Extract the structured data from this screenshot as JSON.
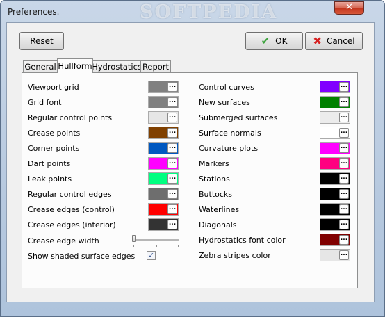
{
  "window": {
    "title": "Preferences.",
    "watermark": "SOFTPEDIA",
    "close_glyph": "✕"
  },
  "toolbar": {
    "reset_label": "Reset",
    "ok_label": "OK",
    "cancel_label": "Cancel",
    "ok_glyph": "✔",
    "cancel_glyph": "✖"
  },
  "tabs": [
    "General",
    "Hullform",
    "Hydrostatics",
    "Report"
  ],
  "active_tab": "Hullform",
  "left_column": [
    {
      "label": "Viewport grid",
      "color": "#808080"
    },
    {
      "label": "Grid font",
      "color": "#808080"
    },
    {
      "label": "Regular control points",
      "color": "#e6e6e6"
    },
    {
      "label": "Crease points",
      "color": "#804000"
    },
    {
      "label": "Corner points",
      "color": "#0058c0"
    },
    {
      "label": "Dart points",
      "color": "#ff00ff"
    },
    {
      "label": "Leak points",
      "color": "#00ff80"
    },
    {
      "label": "Regular control edges",
      "color": "#6e6e6e"
    },
    {
      "label": "Crease edges (control)",
      "color": "#ff0000"
    },
    {
      "label": "Crease edges (interior)",
      "color": "#333333"
    }
  ],
  "right_column": [
    {
      "label": "Control curves",
      "color": "#8000ff"
    },
    {
      "label": "New surfaces",
      "color": "#008000"
    },
    {
      "label": "Submerged surfaces",
      "color": "#ececec"
    },
    {
      "label": "Surface normals",
      "color": "#ffffff"
    },
    {
      "label": "Curvature plots",
      "color": "#ff00ff"
    },
    {
      "label": "Markers",
      "color": "#ff0080"
    },
    {
      "label": "Stations",
      "color": "#000000"
    },
    {
      "label": "Buttocks",
      "color": "#000000"
    },
    {
      "label": "Waterlines",
      "color": "#000000"
    },
    {
      "label": "Diagonals",
      "color": "#000000"
    },
    {
      "label": "Hydrostatics font color",
      "color": "#800000"
    },
    {
      "label": "Zebra stripes color",
      "color": "#e6e6e6"
    }
  ],
  "edge_width": {
    "label": "Crease edge width",
    "value": 1
  },
  "shaded_edges": {
    "label": "Show shaded surface edges",
    "checked": true,
    "mark": "✓"
  },
  "swatch_button_text": "..."
}
